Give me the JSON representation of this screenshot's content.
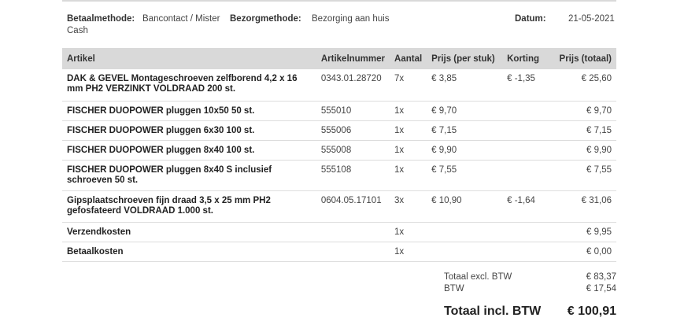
{
  "order_info": {
    "payment_label": "Betaalmethode:",
    "payment_value_line1": "Bancontact / Mister",
    "payment_value_line2": "Cash",
    "delivery_label": "Bezorgmethode:",
    "delivery_value": "Bezorging aan huis",
    "date_label": "Datum:",
    "date_value": "21-05-2021"
  },
  "table": {
    "headers": [
      "Artikel",
      "Artikelnummer",
      "Aantal",
      "Prijs (per stuk)",
      "Korting",
      "Prijs (totaal)"
    ],
    "rows": [
      {
        "article": "DAK & GEVEL Montageschroeven zelfborend 4,2 x 16 mm PH2 VERZINKT VOLDRAAD 200 st.",
        "number": "0343.01.28720",
        "qty": "7x",
        "unit_price": "€ 3,85",
        "discount": "€ -1,35",
        "total": "€ 25,60"
      },
      {
        "article": "FISCHER DUOPOWER pluggen 10x50 50 st.",
        "number": "555010",
        "qty": "1x",
        "unit_price": "€ 9,70",
        "discount": "",
        "total": "€ 9,70"
      },
      {
        "article": "FISCHER DUOPOWER pluggen 6x30 100 st.",
        "number": "555006",
        "qty": "1x",
        "unit_price": "€ 7,15",
        "discount": "",
        "total": "€ 7,15"
      },
      {
        "article": "FISCHER DUOPOWER pluggen 8x40 100 st.",
        "number": "555008",
        "qty": "1x",
        "unit_price": "€ 9,90",
        "discount": "",
        "total": "€ 9,90"
      },
      {
        "article": "FISCHER DUOPOWER pluggen 8x40 S inclusief schroeven 50 st.",
        "number": "555108",
        "qty": "1x",
        "unit_price": "€ 7,55",
        "discount": "",
        "total": "€ 7,55"
      },
      {
        "article": "Gipsplaatschroeven fijn draad 3,5 x 25 mm PH2 gefosfateerd VOLDRAAD 1.000 st.",
        "number": "0604.05.17101",
        "qty": "3x",
        "unit_price": "€ 10,90",
        "discount": "€ -1,64",
        "total": "€ 31,06"
      },
      {
        "article": "Verzendkosten",
        "number": "",
        "qty": "1x",
        "unit_price": "",
        "discount": "",
        "total": "€ 9,95"
      },
      {
        "article": "Betaalkosten",
        "number": "",
        "qty": "1x",
        "unit_price": "",
        "discount": "",
        "total": "€ 0,00"
      }
    ]
  },
  "totals": {
    "excl_label": "Totaal excl. BTW",
    "excl_value": "€ 83,37",
    "btw_label": "BTW",
    "btw_value": "€ 17,54",
    "incl_label": "Totaal incl. BTW",
    "incl_value": "€ 100,91"
  }
}
